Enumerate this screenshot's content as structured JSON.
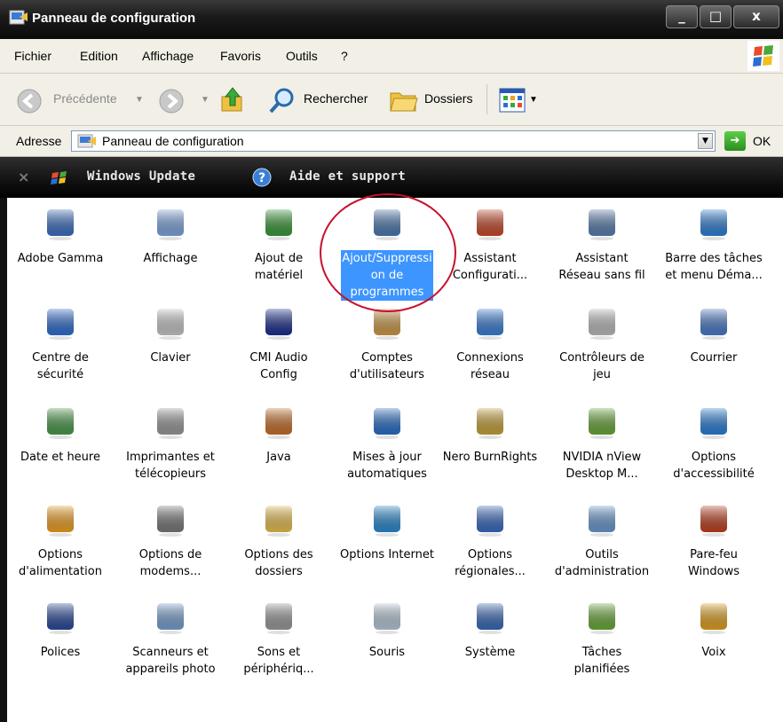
{
  "window": {
    "title": "Panneau de configuration",
    "close_glyph": "x",
    "min_glyph": "_",
    "max_glyph": "□"
  },
  "menu": [
    "Fichier",
    "Edition",
    "Affichage",
    "Favoris",
    "Outils",
    "?"
  ],
  "toolbar": {
    "back_label": "Précédente",
    "search_label": "Rechercher",
    "folders_label": "Dossiers"
  },
  "address": {
    "label": "Adresse",
    "value": "Panneau de configuration",
    "go_label": "OK"
  },
  "links": {
    "windows_update": "Windows Update",
    "help": "Aide et support"
  },
  "items": [
    {
      "label": "Adobe Gamma",
      "icon": "monitor-gamma-icon",
      "color": "#3c6fc1"
    },
    {
      "label": "Affichage",
      "icon": "display-icon",
      "color": "#7ea6df"
    },
    {
      "label": "Ajout de\nmatériel",
      "icon": "hardware-icon",
      "color": "#3a9a3a"
    },
    {
      "label": "Ajout/Suppressi\non de\nprogrammes",
      "icon": "add-remove-programs-icon",
      "color": "#4c7ab0",
      "selected": true
    },
    {
      "label": "Assistant\nConfigurati...",
      "icon": "network-setup-house-icon",
      "color": "#c84a2a"
    },
    {
      "label": "Assistant\nRéseau sans fil",
      "icon": "wireless-icon",
      "color": "#5a7fb0"
    },
    {
      "label": "Barre des tâches\net menu Déma...",
      "icon": "taskbar-icon",
      "color": "#2f7fd6"
    },
    {
      "label": "Centre de\nsécurité",
      "icon": "security-center-icon",
      "color": "#2f6fd0"
    },
    {
      "label": "Clavier",
      "icon": "keyboard-icon",
      "color": "#c8c8c8"
    },
    {
      "label": "CMI Audio\nConfig",
      "icon": "xear-3d-icon",
      "color": "#1c2f8f"
    },
    {
      "label": "Comptes\nd'utilisateurs",
      "icon": "user-accounts-icon",
      "color": "#d09a4a"
    },
    {
      "label": "Connexions\nréseau",
      "icon": "network-connections-icon",
      "color": "#3a7fd6"
    },
    {
      "label": "Contrôleurs de\njeu",
      "icon": "game-controller-icon",
      "color": "#bdbdbd"
    },
    {
      "label": "Courrier",
      "icon": "mail-icon",
      "color": "#4a7ac8"
    },
    {
      "label": "Date et heure",
      "icon": "calendar-icon",
      "color": "#4a9a4a"
    },
    {
      "label": "Imprimantes et\ntélécopieurs",
      "icon": "printer-icon",
      "color": "#9a9a9a"
    },
    {
      "label": "Java",
      "icon": "java-icon",
      "color": "#c8702a"
    },
    {
      "label": "Mises à jour\nautomatiques",
      "icon": "windows-update-icon",
      "color": "#2a6fc8"
    },
    {
      "label": "Nero BurnRights",
      "icon": "lock-disc-icon",
      "color": "#c8a23a"
    },
    {
      "label": "NVIDIA nView\nDesktop M...",
      "icon": "nvidia-icon",
      "color": "#6aa83a"
    },
    {
      "label": "Options\nd'accessibilité",
      "icon": "accessibility-icon",
      "color": "#2a80d8"
    },
    {
      "label": "Options\nd'alimentation",
      "icon": "battery-icon",
      "color": "#f0a020"
    },
    {
      "label": "Options de\nmodems...",
      "icon": "modem-icon",
      "color": "#7a7a7a"
    },
    {
      "label": "Options des\ndossiers",
      "icon": "folder-options-icon",
      "color": "#e8c050"
    },
    {
      "label": "Options Internet",
      "icon": "internet-options-icon",
      "color": "#2a8ad0"
    },
    {
      "label": "Options\nrégionales...",
      "icon": "globe-icon",
      "color": "#3a6ac0"
    },
    {
      "label": "Outils\nd'administration",
      "icon": "admin-tools-icon",
      "color": "#6a9ad0"
    },
    {
      "label": "Pare-feu\nWindows",
      "icon": "firewall-icon",
      "color": "#c04020"
    },
    {
      "label": "Polices",
      "icon": "fonts-icon",
      "color": "#2a4a9a"
    },
    {
      "label": "Scanneurs et\nappareils photo",
      "icon": "scanner-camera-icon",
      "color": "#7aa0d0"
    },
    {
      "label": "Sons et\npériphériq...",
      "icon": "speaker-icon",
      "color": "#9a9a9a"
    },
    {
      "label": "Souris",
      "icon": "mouse-icon",
      "color": "#b8c8d8"
    },
    {
      "label": "Système",
      "icon": "system-monitor-icon",
      "color": "#3a6ab8"
    },
    {
      "label": "Tâches\nplanifiées",
      "icon": "scheduled-tasks-icon",
      "color": "#6aaa3a"
    },
    {
      "label": "Voix",
      "icon": "speech-icon",
      "color": "#e0a020"
    }
  ]
}
